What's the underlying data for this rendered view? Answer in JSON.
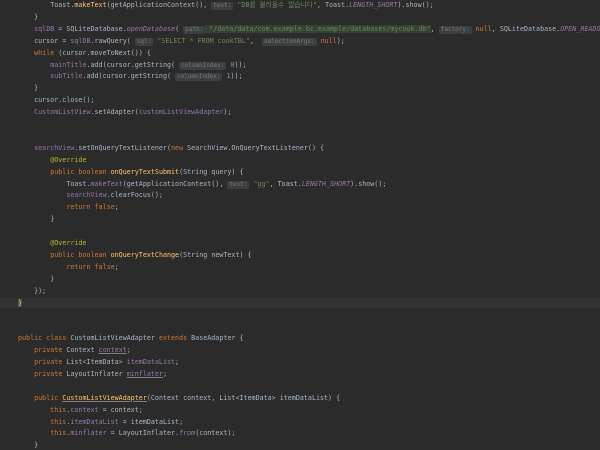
{
  "editor": {
    "lines": [
      [
        {
          "t": "        Toast."
        },
        {
          "t": "makeText",
          "c": "fn"
        },
        {
          "t": "(getApplicationContext(), "
        },
        {
          "t": "text:",
          "c": "hint"
        },
        {
          "t": " \"DB를 불러올수 없습니다\"",
          "c": "str"
        },
        {
          "t": ", Toast."
        },
        {
          "t": "LENGTH_SHORT",
          "c": "st"
        },
        {
          "t": ").show();"
        }
      ],
      [
        {
          "t": "    }"
        }
      ],
      [
        {
          "t": "    "
        },
        {
          "t": "sqlDB",
          "c": "fld"
        },
        {
          "t": " = SQLiteDatabase."
        },
        {
          "t": "openDatabase",
          "c": "st"
        },
        {
          "t": "( "
        },
        {
          "t": "path:",
          "c": "hint"
        },
        {
          "t": " \"/data/data/com.example.bc.example/databases/mycook.db\"",
          "c": "str hl-str"
        },
        {
          "t": ", "
        },
        {
          "t": "factory:",
          "c": "hint"
        },
        {
          "t": " "
        },
        {
          "t": "null",
          "c": "kw"
        },
        {
          "t": ", SQLiteDatabase."
        },
        {
          "t": "OPEN_READONLY",
          "c": "st"
        },
        {
          "t": ");"
        }
      ],
      [
        {
          "t": "    cursor = "
        },
        {
          "t": "sqlDB",
          "c": "fld"
        },
        {
          "t": ".rawQuery( "
        },
        {
          "t": "sql:",
          "c": "hint"
        },
        {
          "t": " \"SELECT * FROM cookTBL\"",
          "c": "str"
        },
        {
          "t": ",  "
        },
        {
          "t": "selectionArgs:",
          "c": "hint"
        },
        {
          "t": " "
        },
        {
          "t": "null",
          "c": "kw"
        },
        {
          "t": ");"
        }
      ],
      [
        {
          "t": "    "
        },
        {
          "t": "while",
          "c": "kw"
        },
        {
          "t": " (cursor.moveToNext()) {"
        }
      ],
      [
        {
          "t": "        "
        },
        {
          "t": "mainTitle",
          "c": "fld"
        },
        {
          "t": ".add(cursor.getString( "
        },
        {
          "t": "columnIndex:",
          "c": "hint"
        },
        {
          "t": " "
        },
        {
          "t": "0",
          "c": "num"
        },
        {
          "t": "));"
        }
      ],
      [
        {
          "t": "        "
        },
        {
          "t": "subTitle",
          "c": "fld"
        },
        {
          "t": ".add(cursor.getString( "
        },
        {
          "t": "columnIndex:",
          "c": "hint"
        },
        {
          "t": " "
        },
        {
          "t": "1",
          "c": "num"
        },
        {
          "t": "));"
        }
      ],
      [
        {
          "t": "    }"
        }
      ],
      [
        {
          "t": "    cursor.close();"
        }
      ],
      [
        {
          "t": "    "
        },
        {
          "t": "CustomListView",
          "c": "fld"
        },
        {
          "t": ".setAdapter("
        },
        {
          "t": "customListViewAdapter",
          "c": "fld"
        },
        {
          "t": ");"
        }
      ],
      [
        {
          "t": ""
        }
      ],
      [
        {
          "t": ""
        }
      ],
      [
        {
          "t": "    "
        },
        {
          "t": "searchView",
          "c": "fld"
        },
        {
          "t": ".setOnQueryTextListener("
        },
        {
          "t": "new",
          "c": "kw"
        },
        {
          "t": " SearchView.OnQueryTextListener() {"
        }
      ],
      [
        {
          "t": "        "
        },
        {
          "t": "@Override",
          "c": "ann"
        }
      ],
      [
        {
          "t": "        "
        },
        {
          "t": "public boolean",
          "c": "kw"
        },
        {
          "t": " "
        },
        {
          "t": "onQueryTextSubmit",
          "c": "fn"
        },
        {
          "t": "(String query) {"
        }
      ],
      [
        {
          "t": "            Toast."
        },
        {
          "t": "makeText",
          "c": "st"
        },
        {
          "t": "(getApplicationContext(), "
        },
        {
          "t": "text:",
          "c": "hint"
        },
        {
          "t": " \"gg\"",
          "c": "str"
        },
        {
          "t": ", Toast."
        },
        {
          "t": "LENGTH_SHORT",
          "c": "st"
        },
        {
          "t": ").show();"
        }
      ],
      [
        {
          "t": "            "
        },
        {
          "t": "searchView",
          "c": "fld"
        },
        {
          "t": ".clearFocus();"
        }
      ],
      [
        {
          "t": "            "
        },
        {
          "t": "return false",
          "c": "kw"
        },
        {
          "t": ";"
        }
      ],
      [
        {
          "t": "        }"
        }
      ],
      [
        {
          "t": ""
        }
      ],
      [
        {
          "t": "        "
        },
        {
          "t": "@Override",
          "c": "ann"
        }
      ],
      [
        {
          "t": "        "
        },
        {
          "t": "public boolean",
          "c": "kw"
        },
        {
          "t": " "
        },
        {
          "t": "onQueryTextChange",
          "c": "fn"
        },
        {
          "t": "(String newText) {"
        }
      ],
      [
        {
          "t": "            "
        },
        {
          "t": "return false",
          "c": "kw"
        },
        {
          "t": ";"
        }
      ],
      [
        {
          "t": "        }"
        }
      ],
      [
        {
          "t": "    });"
        }
      ],
      [
        {
          "t": "}",
          "c": "brace-hl"
        }
      ],
      [
        {
          "t": ""
        }
      ],
      [
        {
          "t": ""
        }
      ],
      [
        {
          "t": "public class",
          "c": "kw"
        },
        {
          "t": " CustomListViewAdapter "
        },
        {
          "t": "extends",
          "c": "kw"
        },
        {
          "t": " BaseAdapter {"
        }
      ],
      [
        {
          "t": "    "
        },
        {
          "t": "private",
          "c": "kw"
        },
        {
          "t": " Context "
        },
        {
          "t": "context",
          "c": "fld ul"
        },
        {
          "t": ";"
        }
      ],
      [
        {
          "t": "    "
        },
        {
          "t": "private",
          "c": "kw"
        },
        {
          "t": " List<ItemData> "
        },
        {
          "t": "itemDataList",
          "c": "fld"
        },
        {
          "t": ";"
        }
      ],
      [
        {
          "t": "    "
        },
        {
          "t": "private",
          "c": "kw"
        },
        {
          "t": " LayoutInflater "
        },
        {
          "t": "minflater",
          "c": "fld ul"
        },
        {
          "t": ";"
        }
      ],
      [
        {
          "t": ""
        }
      ],
      [
        {
          "t": "    "
        },
        {
          "t": "public",
          "c": "kw"
        },
        {
          "t": " "
        },
        {
          "t": "CustomListViewAdapter",
          "c": "fn ul"
        },
        {
          "t": "(Context context, List<ItemData> itemDataList) {"
        }
      ],
      [
        {
          "t": "        "
        },
        {
          "t": "this",
          "c": "kw"
        },
        {
          "t": "."
        },
        {
          "t": "context",
          "c": "fld"
        },
        {
          "t": " = context;"
        }
      ],
      [
        {
          "t": "        "
        },
        {
          "t": "this",
          "c": "kw"
        },
        {
          "t": "."
        },
        {
          "t": "itemDataList",
          "c": "fld"
        },
        {
          "t": " = itemDataList;"
        }
      ],
      [
        {
          "t": "        "
        },
        {
          "t": "this",
          "c": "kw"
        },
        {
          "t": "."
        },
        {
          "t": "minflater",
          "c": "fld"
        },
        {
          "t": " = LayoutInflater."
        },
        {
          "t": "from",
          "c": "st"
        },
        {
          "t": "(context);"
        }
      ],
      [
        {
          "t": "    }"
        }
      ]
    ],
    "current_line": 25
  }
}
